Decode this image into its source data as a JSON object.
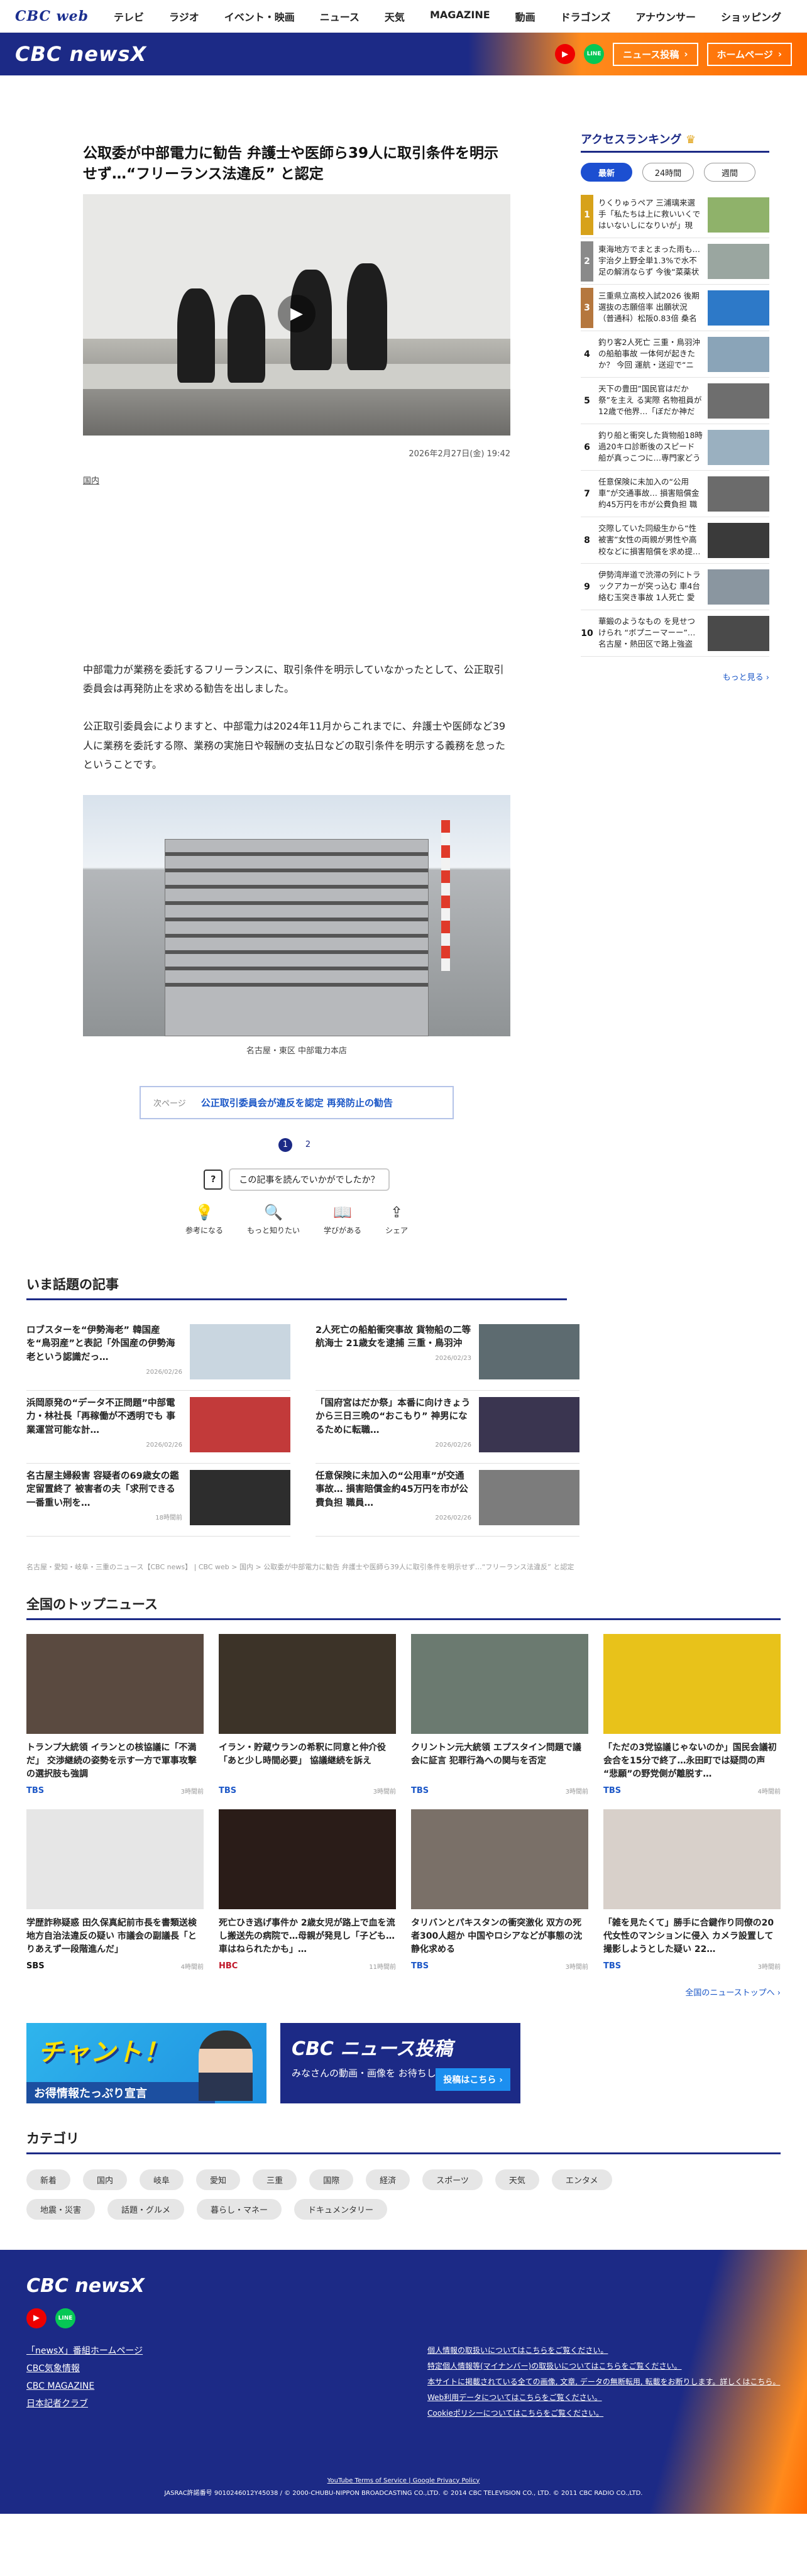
{
  "topnav": {
    "logo": "CBC web",
    "items": [
      "テレビ",
      "ラジオ",
      "イベント・映画",
      "ニュース",
      "天気",
      "MAGAZINE",
      "動画",
      "ドラゴンズ",
      "アナウンサー",
      "ショッピング"
    ]
  },
  "header": {
    "brand": "CBC newsX",
    "youtube": "▶",
    "line": "LINE",
    "post_button": "ニュース投稿",
    "home_button": "ホームページ"
  },
  "article": {
    "title": "公取委が中部電力に勧告 弁護士や医師ら39人に取引条件を明示せず…“フリーランス法違反” と認定",
    "date": "2026年2月27日(金) 19:42",
    "category": "国内",
    "p1": "中部電力が業務を委託するフリーランスに、取引条件を明示していなかったとして、公正取引委員会は再発防止を求める勧告を出しました。",
    "p2": "公正取引委員会によりますと、中部電力は2024年11月からこれまでに、弁護士や医師など39人に業務を委託する際、業務の実施日や報酬の支払日などの取引条件を明示する義務を怠ったということです。",
    "photo_caption": "名古屋・東区 中部電力本店",
    "next_label": "次ページ",
    "next_title": "公正取引委員会が違反を認定 再発防止の勧告",
    "pages": [
      "1",
      "2"
    ],
    "feedback_q": "この記事を読んでいかがでしたか？",
    "reactions": [
      {
        "icon": "💡",
        "label": "参考になる"
      },
      {
        "icon": "🔍",
        "label": "もっと知りたい"
      },
      {
        "icon": "📖",
        "label": "学びがある"
      },
      {
        "icon": "⇪",
        "label": "シェア"
      }
    ]
  },
  "ranking": {
    "title": "アクセスランキング",
    "tabs": [
      "最新",
      "24時間",
      "週間"
    ],
    "items": [
      {
        "n": "1",
        "text": "りくりゅうペア 三浦璃来選手「私たちは上に救いいくではいないしになりいが」現事…",
        "color": "#8fb26a"
      },
      {
        "n": "2",
        "text": "東海地方でまとまった雨も…宇治夕上野全単1.3%で水不足の解消ならず 今後“菜薬状態…",
        "color": "#9aa6a0"
      },
      {
        "n": "3",
        "text": "三重県立高校入試2026 後期選抜の志願倍率 出願状況（普通科）松阪0.83倍 桑名1.0?倍…",
        "color": "#2d79c8"
      },
      {
        "n": "4",
        "text": "釣り客2人死亡 三重・鳥羽沖の船舶事故 一体何が起きたか？ 今回 運航・送迎で“ニー…",
        "color": "#8aa4b8"
      },
      {
        "n": "5",
        "text": "天下の豊田”国民官はだか祭”を主え る実際 名物祖員が12歳で他界…「ぼだか神だと…",
        "color": "#6e6e6e"
      },
      {
        "n": "6",
        "text": "釣り船と衝突した貨物船18時過20キロ診断後のスピード 船が真っこつに…専門家どう見…",
        "color": "#9ab0c0"
      },
      {
        "n": "7",
        "text": "任意保険に未加入の“公用車”が交通事故… 損害賠償金約45万円を市が公費負担 職員…",
        "color": "#6b6b6b"
      },
      {
        "n": "8",
        "text": "交際していた同級生から“性被害”女性の両親が男性や高校などに損害賠償を求め提…",
        "color": "#3a3a3a"
      },
      {
        "n": "9",
        "text": "伊勢湾岸道で渋滞の列にトラックアカーが突っ込む 車4台絡む玉突き事故 1人死亡 愛知…",
        "color": "#8a96a0"
      },
      {
        "n": "10",
        "text": "華鍛のようなもの を見せつけられ “ボプニーマーー”…名古屋・熱田区で路上強盗 男…",
        "color": "#4a4a4a"
      }
    ],
    "more": "もっと見る ›"
  },
  "trending": {
    "title": "いま話題の記事",
    "items": [
      {
        "t": "ロブスターを“伊勢海老” 韓国産を“鳥羽産”と表記「外国産の伊勢海老という認識だっ…",
        "d": "2026/02/26",
        "c": "#c9d6e0"
      },
      {
        "t": "2人死亡の船舶衝突事故 貨物船の二等航海士 21歳女を逮捕 三重・鳥羽沖",
        "d": "2026/02/23",
        "c": "#5d6b70"
      },
      {
        "t": "浜岡原発の“データ不正問題”中部電力・林社長「再稼働が不透明でも 事業運営可能な計…",
        "d": "2026/02/26",
        "c": "#c23a3a"
      },
      {
        "t": "「国府宮はだか祭」本番に向けきょうから三日三晩の“おこもり” 神男になるために転職…",
        "d": "2026/02/26",
        "c": "#3a3550"
      },
      {
        "t": "名古屋主婦殺害 容疑者の69歳女の鑑定留置終了 被害者の夫「求刑できる一番重い刑を…",
        "d": "18時間前",
        "c": "#2d2d2d"
      },
      {
        "t": "任意保険に未加入の“公用車”が交通事故… 損害賠償金約45万円を市が公費負担 職員…",
        "d": "2026/02/26",
        "c": "#7c7c7c"
      }
    ]
  },
  "breadcrumb": "名古屋・愛知・岐阜・三重のニュース【CBC news】 | CBC web > 国内 > 公取委が中部電力に勧告 弁護士や医師ら39人に取引条件を明示せず…“フリーランス法違反” と認定",
  "topnews": {
    "title": "全国のトップニュース",
    "items": [
      {
        "t": "トランプ大統領 イランとの核協議に「不満だ」 交渉継続の姿勢を示す一方で軍事攻撃の選択肢も強調",
        "s": "TBS",
        "a": "3時間前",
        "c": "#5a4a40"
      },
      {
        "t": "イラン・貯蔵ウランの希釈に同意と仲介役 「あと少し時間必要」 協議継続を訴え",
        "s": "TBS",
        "a": "3時間前",
        "c": "#3c3328"
      },
      {
        "t": "クリントン元大統領 エプスタイン問題で議会に証言 犯罪行為への関与を否定",
        "s": "TBS",
        "a": "3時間前",
        "c": "#6b7a70"
      },
      {
        "t": "「ただの3党協議じゃないのか」国民会議初会合を15分で終了…永田町では疑問の声 “悲願”の野党側が離脱す…",
        "s": "TBS",
        "a": "4時間前",
        "c": "#e8c21a"
      },
      {
        "t": "学歴詐称疑惑 田久保真紀前市長を書類送検 地方自治法違反の疑い 市議会の副議長「とりあえず一段階進んだ」",
        "s": "SBS",
        "a": "4時間前",
        "c": "#e6e6e6"
      },
      {
        "t": "死亡ひき逃げ事件か 2歳女児が路上で血を流し搬送先の病院で…母親が発見し「子ども…車はねられたかも」…",
        "s": "HBC",
        "a": "11時間前",
        "c": "#2a1c18"
      },
      {
        "t": "タリバンとパキスタンの衝突激化 双方の死者300人超か 中国やロシアなどが事態の沈静化求める",
        "s": "TBS",
        "a": "3時間前",
        "c": "#7a7068"
      },
      {
        "t": "「雑を見たくて」勝手に合鍵作り同僚の20代女性のマンションに侵入 カメラ設置して撮影しようとした疑い 22…",
        "s": "TBS",
        "a": "3時間前",
        "c": "#d8d0ca"
      }
    ],
    "all": "全国のニューストップへ ›"
  },
  "banners": {
    "chant_big": "チャント！",
    "chant_sub": "お得情報たっぷり宣言",
    "post_title": "CBC ニュース投稿",
    "post_text": "みなさんの動画・画像を お待ちしています。",
    "post_btn": "投稿はこちら ›"
  },
  "categories": {
    "title": "カテゴリ",
    "items": [
      "新着",
      "国内",
      "岐阜",
      "愛知",
      "三重",
      "国際",
      "経済",
      "スポーツ",
      "天気",
      "エンタメ",
      "地震・災害",
      "話題・グルメ",
      "暮らし・マネー",
      "ドキュメンタリー"
    ]
  },
  "footer": {
    "brand": "CBC newsX",
    "links": [
      "「newsX」番組ホームページ",
      "CBC気象情報",
      "CBC MAGAZINE",
      "日本記者クラブ"
    ],
    "notes": [
      "個人情報の取扱いについてはこちらをご覧ください。",
      "特定個人情報等(マイナンバー)の取扱いについてはこちらをご覧ください。",
      "本サイトに掲載されている全ての画像, 文章, データの無断転用, 転載をお断りします。詳しくはこちら。",
      "Web利用データについてはこちらをご覧ください。",
      "Cookieポリシーについてはこちらをご覧ください。"
    ],
    "policy": "YouTube Terms of Service | Google Privacy Policy",
    "copyright": "JASRAC許諾番号 9010246012Y45038 / © 2000-CHUBU-NIPPON BROADCASTING CO.,LTD. © 2014 CBC TELEVISION CO., LTD. © 2011 CBC RADIO CO.,LTD."
  }
}
